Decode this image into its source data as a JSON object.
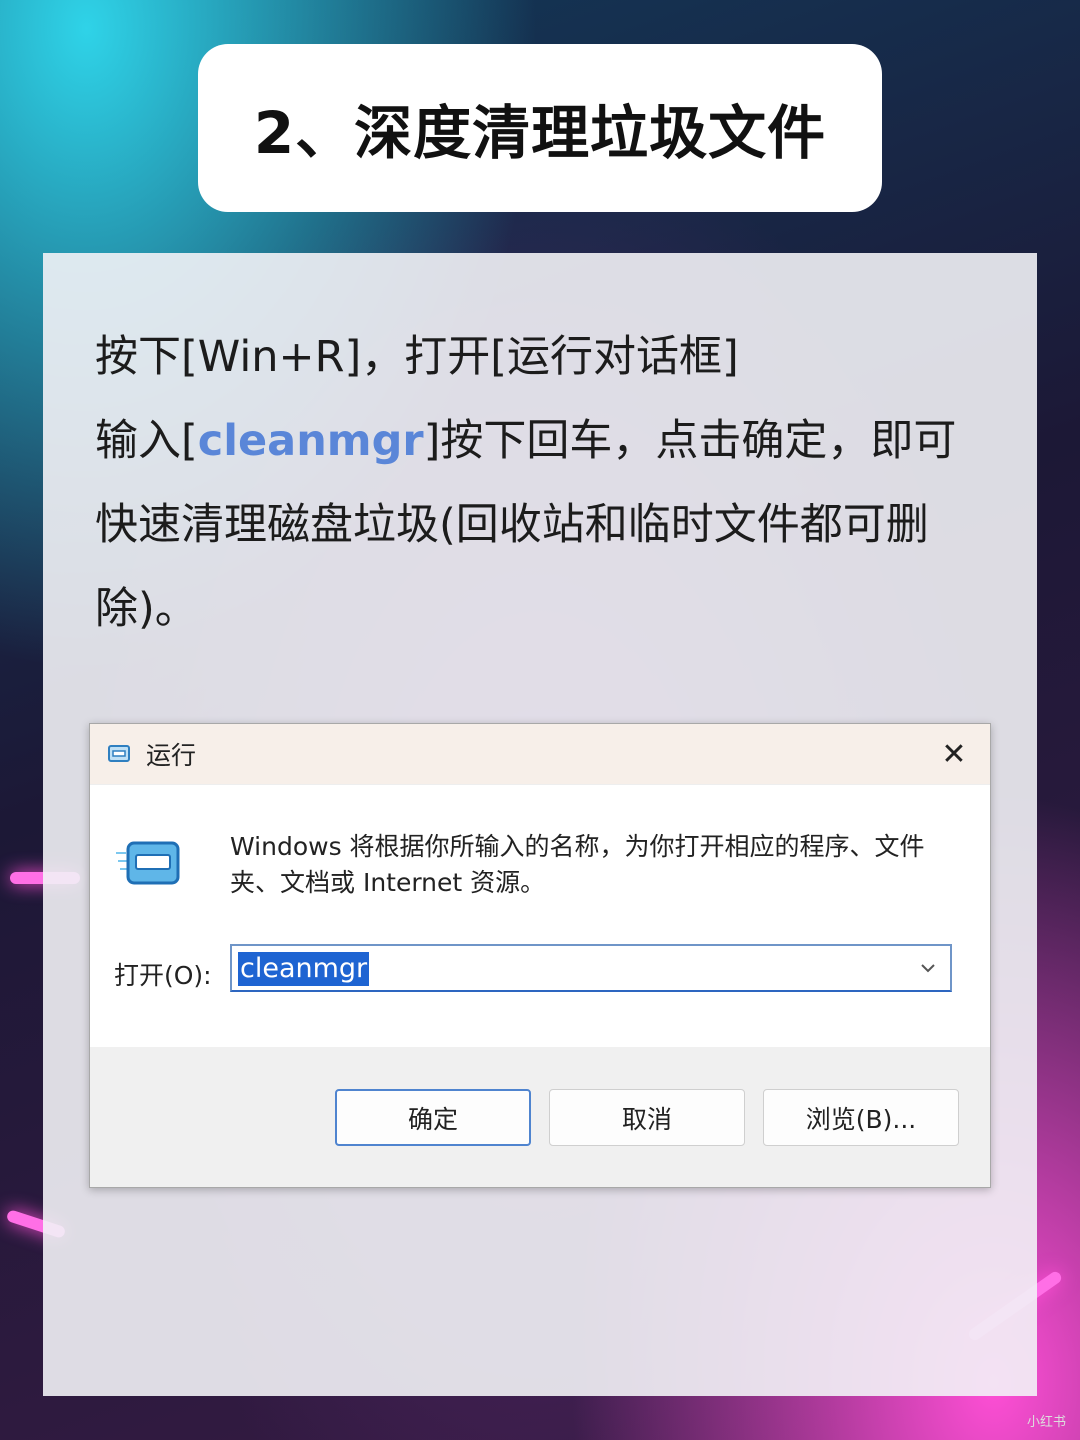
{
  "title": "2、深度清理垃圾文件",
  "instructions": {
    "line1": "按下[Win+R]，打开[运行对话框]",
    "line2_prefix": "输入[",
    "line2_keyword": "cleanmgr",
    "line2_suffix": "]按下回车，点击确定，即可快速清理磁盘垃圾(回收站和临时文件都可删除)。"
  },
  "dialog": {
    "title": "运行",
    "close_glyph": "✕",
    "message": "Windows 将根据你所输入的名称，为你打开相应的程序、文件夹、文档或 Internet 资源。",
    "open_label": "打开(O):",
    "input_value": "cleanmgr",
    "buttons": {
      "ok": "确定",
      "cancel": "取消",
      "browse": "浏览(B)..."
    },
    "icons": [
      "run-dialog-icon",
      "close-icon",
      "chevron-down-icon"
    ]
  },
  "watermark": "小红书",
  "colors": {
    "keyword": "#5a86d8",
    "selection": "#1e64d2",
    "primary_border": "#4f84cf"
  }
}
